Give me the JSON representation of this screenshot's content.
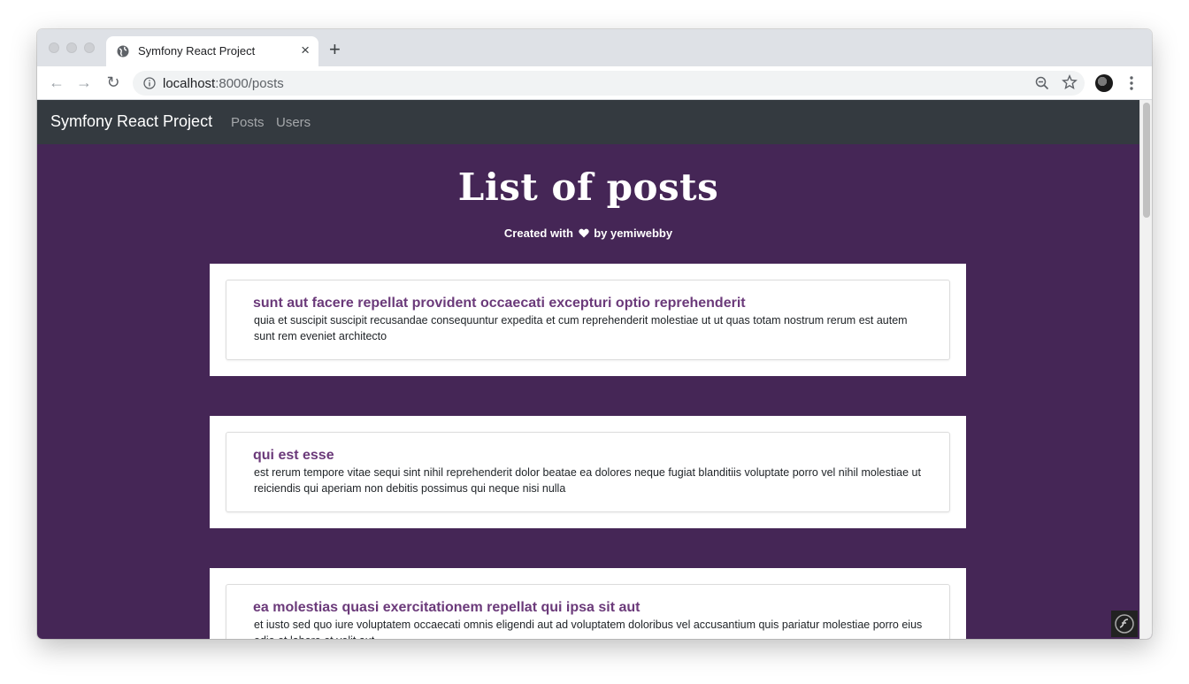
{
  "browser": {
    "tab_title": "Symfony React Project",
    "tab_close": "×",
    "new_tab": "+",
    "url_host": "localhost",
    "url_rest": ":8000/posts"
  },
  "navbar": {
    "brand": "Symfony React Project",
    "links": [
      "Posts",
      "Users"
    ]
  },
  "hero": {
    "title": "List of posts",
    "subtitle_before": "Created with",
    "subtitle_after": "by yemiwebby"
  },
  "posts": [
    {
      "title": "sunt aut facere repellat provident occaecati excepturi optio reprehenderit",
      "body": "quia et suscipit suscipit recusandae consequuntur expedita et cum reprehenderit molestiae ut ut quas totam nostrum rerum est autem sunt rem eveniet architecto"
    },
    {
      "title": "qui est esse",
      "body": "est rerum tempore vitae sequi sint nihil reprehenderit dolor beatae ea dolores neque fugiat blanditiis voluptate porro vel nihil molestiae ut reiciendis qui aperiam non debitis possimus qui neque nisi nulla"
    },
    {
      "title": "ea molestias quasi exercitationem repellat qui ipsa sit aut",
      "body": "et iusto sed quo iure voluptatem occaecati omnis eligendi aut ad voluptatem doloribus vel accusantium quis pariatur molestiae porro eius odio et labore et velit aut"
    }
  ],
  "colors": {
    "page_bg": "#452656",
    "navbar_bg": "#343a40",
    "post_title": "#6b3a7a"
  }
}
